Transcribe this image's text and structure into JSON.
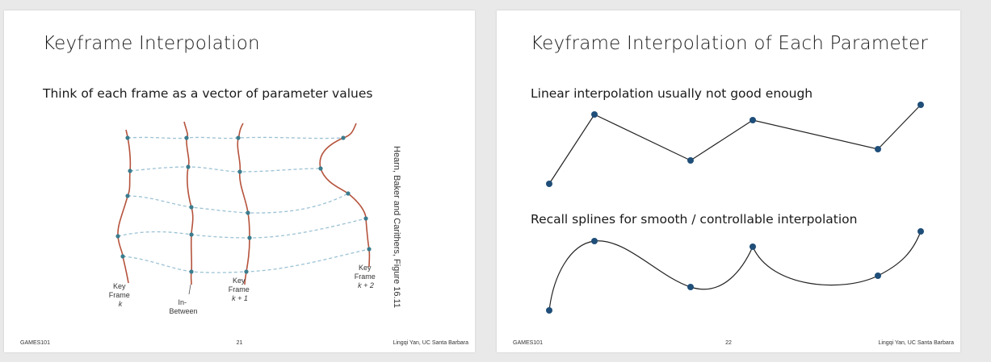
{
  "slides": [
    {
      "title": "Keyframe Interpolation",
      "subtitle": "Think of each frame as a vector of parameter values",
      "credit": "Hearn, Baker and Carithers, Figure 16.11",
      "figure_labels": {
        "key_k": [
          "Key",
          "Frame",
          "k"
        ],
        "in_between": [
          "In-",
          "Between"
        ],
        "key_k1": [
          "Key",
          "Frame",
          "k + 1"
        ],
        "key_k2": [
          "Key",
          "Frame",
          "k + 2"
        ]
      },
      "footer": {
        "left": "GAMES101",
        "page": "21",
        "right": "Lingqi Yan, UC Santa Barbara"
      }
    },
    {
      "title": "Keyframe Interpolation of Each Parameter",
      "linear_text": "Linear interpolation usually not good enough",
      "spline_text": "Recall splines for smooth / controllable interpolation",
      "footer": {
        "left": "GAMES101",
        "page": "22",
        "right": "Lingqi Yan, UC Santa Barbara"
      }
    }
  ],
  "colors": {
    "curve_red": "#b5533c",
    "dashed_blue": "#9cc2d4",
    "point_dark": "#1f4e79",
    "figure_point": "#3a7c8e"
  }
}
